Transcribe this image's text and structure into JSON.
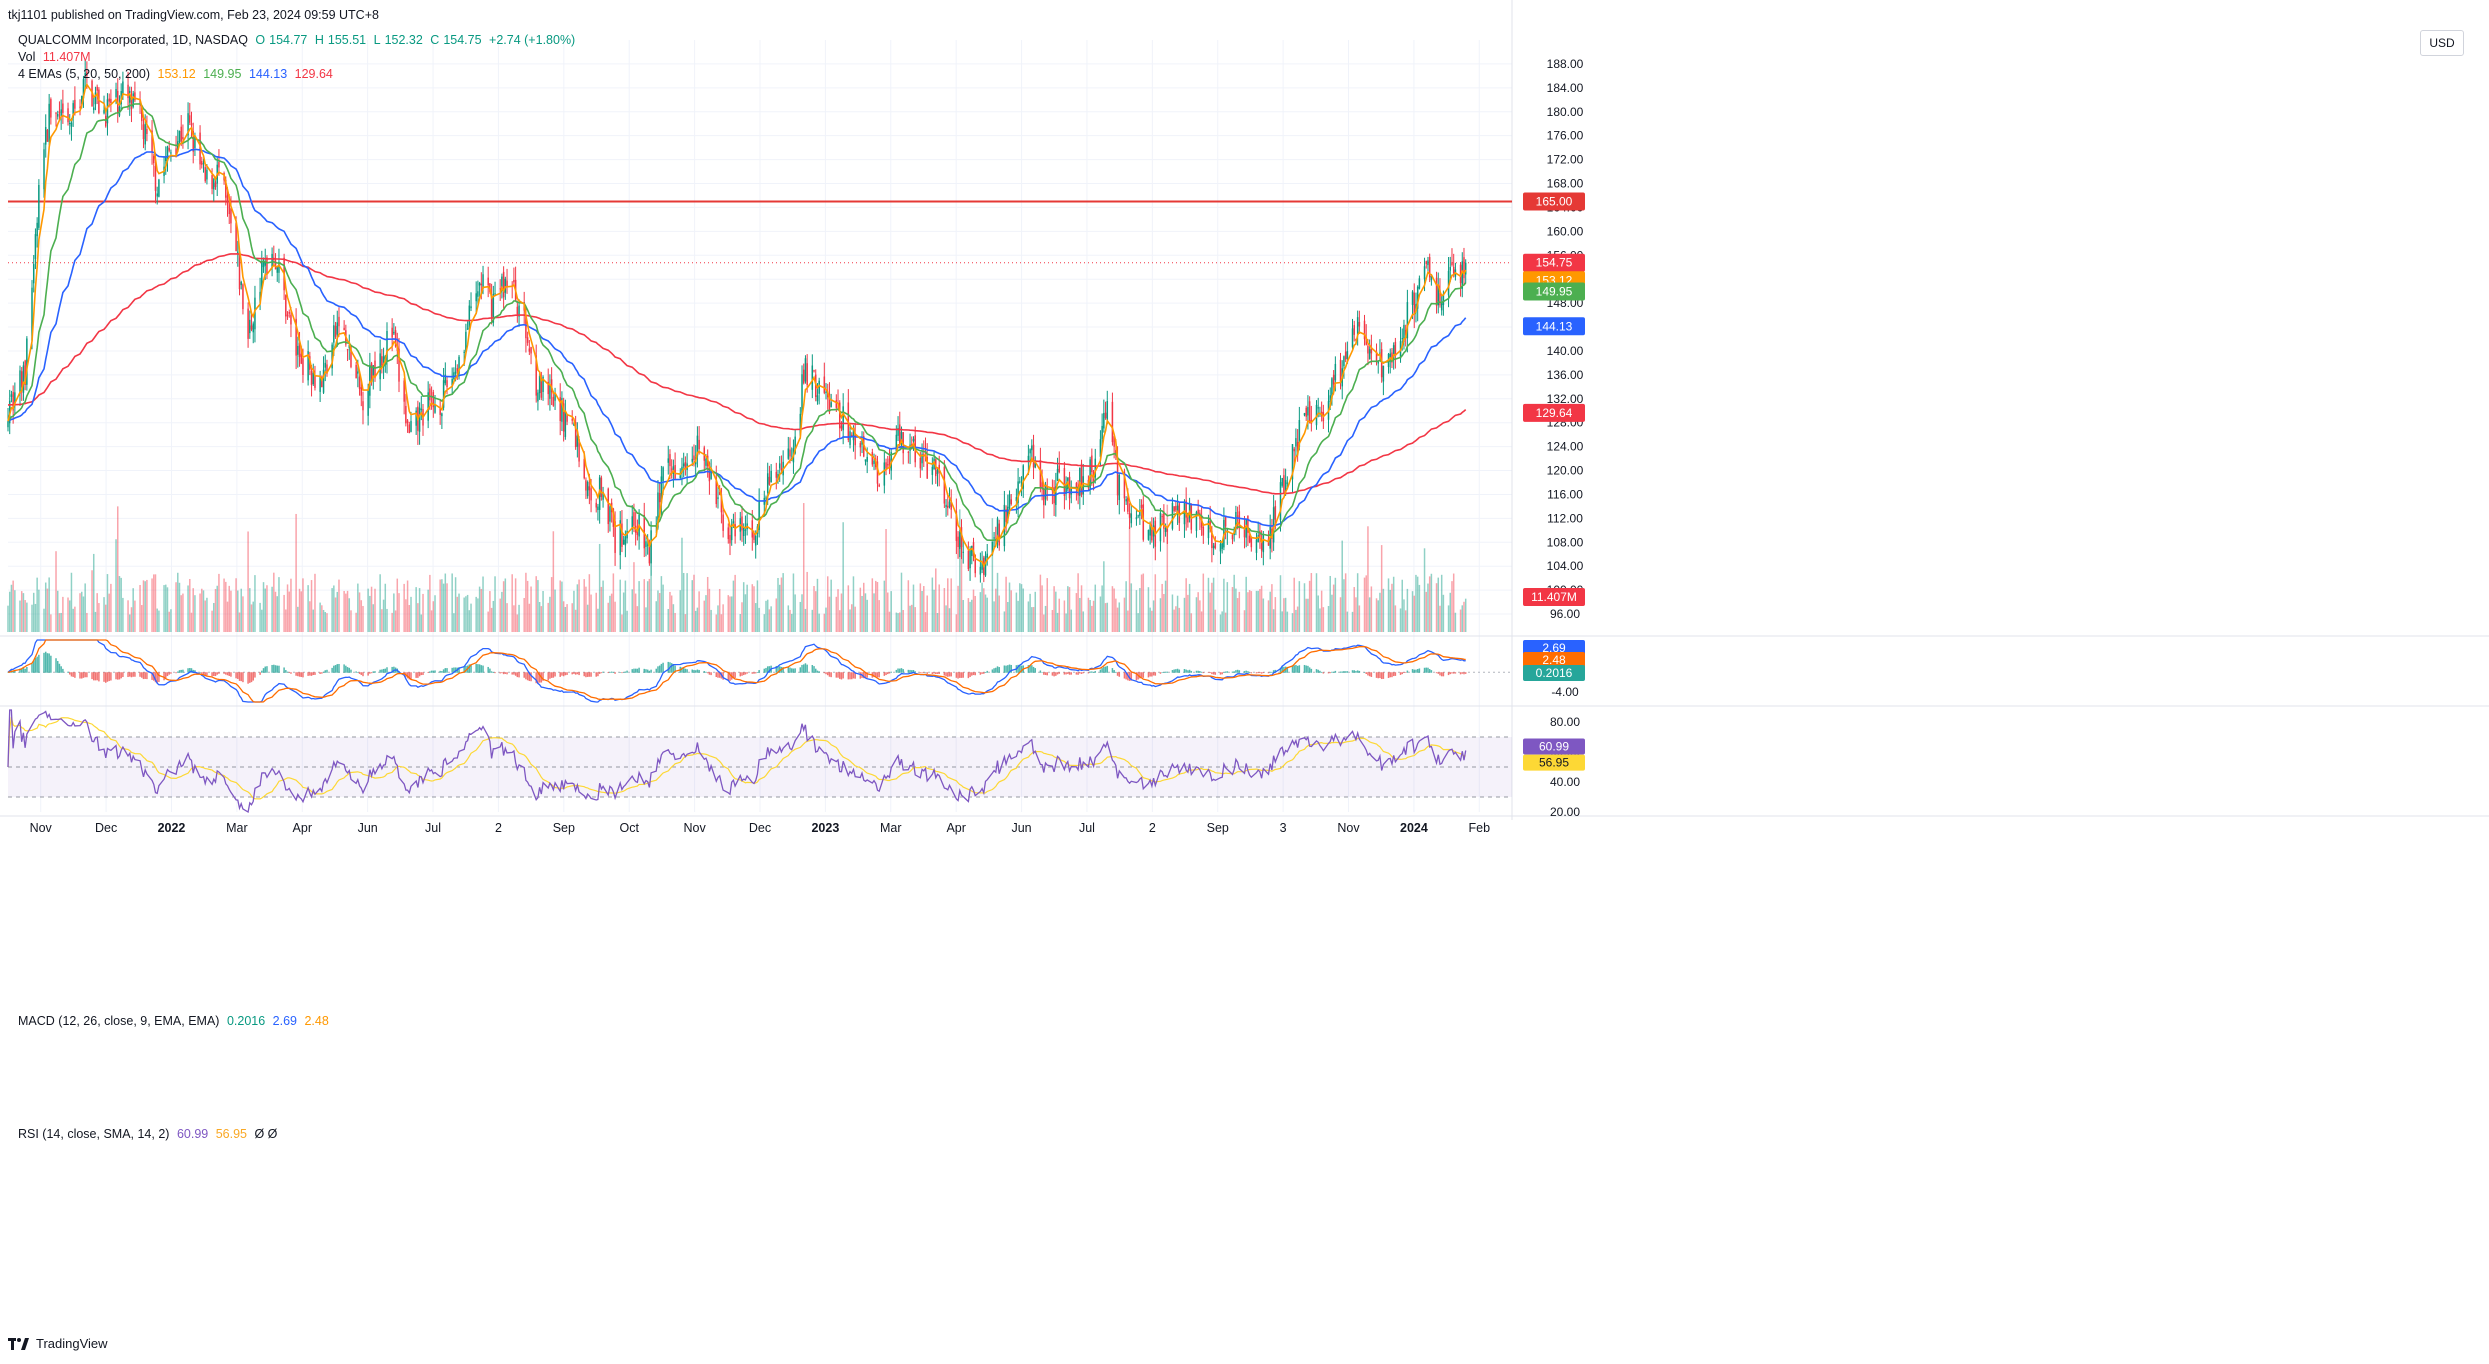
{
  "header": {
    "published": "tkj1101 published on TradingView.com, Feb 23, 2024 09:59 UTC+8",
    "symbol": "QUALCOMM Incorporated, 1D, NASDAQ",
    "open_label": "O",
    "open": "154.77",
    "high_label": "H",
    "high": "155.51",
    "low_label": "L",
    "low": "152.32",
    "close_label": "C",
    "close": "154.75",
    "change": "+2.74 (+1.80%)",
    "vol_label": "Vol",
    "vol": "11.407M",
    "ema_label": "4 EMAs (5, 20, 50, 200)",
    "ema5": "153.12",
    "ema20": "149.95",
    "ema50": "144.13",
    "ema200": "129.64"
  },
  "currency": "USD",
  "footer": {
    "brand": "TradingView"
  },
  "macd_header": {
    "label": "MACD (12, 26, close, 9, EMA, EMA)",
    "hist": "0.2016",
    "macd": "2.69",
    "signal": "2.48"
  },
  "rsi_header": {
    "label": "RSI (14, close, SMA, 14, 2)",
    "rsi": "60.99",
    "ma": "56.95",
    "extra": "Ø Ø"
  },
  "colors": {
    "up": "#089981",
    "down": "#f23645",
    "ema5": "#ff9800",
    "ema20": "#4caf50",
    "ema50": "#2962ff",
    "ema200": "#f23645",
    "rsi": "#7e57c2",
    "rsi_ma": "#fdd835",
    "hline": "#e53935"
  },
  "chart_data": [
    {
      "type": "candlestick",
      "title": "QUALCOMM Incorporated, 1D, NASDAQ",
      "ylim": [
        93,
        192
      ],
      "y_ticks": [
        96,
        100,
        104,
        108,
        112,
        116,
        120,
        124,
        128,
        132,
        136,
        140,
        144,
        148,
        152,
        156,
        160,
        164,
        168,
        172,
        176,
        180,
        184,
        188
      ],
      "x_ticks": [
        "Nov",
        "Dec",
        "2022",
        "Mar",
        "Apr",
        "Jun",
        "Jul",
        "2",
        "Sep",
        "Oct",
        "Nov",
        "Dec",
        "2023",
        "Mar",
        "Apr",
        "Jun",
        "Jul",
        "2",
        "Sep",
        "3",
        "Nov",
        "2024",
        "Feb"
      ],
      "x_range": [
        "2021-10-25",
        "2024-03-20"
      ],
      "horizontal_line": {
        "value": 165.0,
        "label": "165.00"
      },
      "last_price_line": 154.75,
      "price_labels": [
        {
          "value": 154.75,
          "label": "154.75",
          "color": "#f23645"
        },
        {
          "value": 153.12,
          "label": "153.12",
          "color": "#ff9800"
        },
        {
          "value": 149.95,
          "label": "149.95",
          "color": "#4caf50"
        },
        {
          "value": 144.13,
          "label": "144.13",
          "color": "#2962ff"
        },
        {
          "value": 129.64,
          "label": "129.64",
          "color": "#f23645"
        }
      ],
      "volume_label": "11.407M",
      "price_anchors": [
        [
          "2021-10-25",
          131
        ],
        [
          "2021-11-04",
          136
        ],
        [
          "2021-11-12",
          166
        ],
        [
          "2021-11-18",
          180
        ],
        [
          "2021-11-29",
          177
        ],
        [
          "2021-12-09",
          185
        ],
        [
          "2021-12-20",
          180
        ],
        [
          "2021-12-31",
          183
        ],
        [
          "2022-01-10",
          179
        ],
        [
          "2022-01-20",
          168
        ],
        [
          "2022-01-28",
          174
        ],
        [
          "2022-02-07",
          178
        ],
        [
          "2022-02-17",
          168
        ],
        [
          "2022-02-25",
          170
        ],
        [
          "2022-03-07",
          156
        ],
        [
          "2022-03-14",
          142
        ],
        [
          "2022-03-22",
          153
        ],
        [
          "2022-03-29",
          157
        ],
        [
          "2022-04-11",
          140
        ],
        [
          "2022-04-26",
          135
        ],
        [
          "2022-05-06",
          145
        ],
        [
          "2022-05-19",
          132
        ],
        [
          "2022-05-27",
          138
        ],
        [
          "2022-06-06",
          143
        ],
        [
          "2022-06-16",
          125
        ],
        [
          "2022-06-24",
          130
        ],
        [
          "2022-07-05",
          132
        ],
        [
          "2022-07-14",
          138
        ],
        [
          "2022-07-28",
          152
        ],
        [
          "2022-08-02",
          148
        ],
        [
          "2022-08-12",
          152
        ],
        [
          "2022-08-19",
          148
        ],
        [
          "2022-08-30",
          134
        ],
        [
          "2022-09-09",
          131
        ],
        [
          "2022-09-20",
          127
        ],
        [
          "2022-09-30",
          114
        ],
        [
          "2022-10-07",
          118
        ],
        [
          "2022-10-14",
          108
        ],
        [
          "2022-10-25",
          112
        ],
        [
          "2022-11-03",
          106
        ],
        [
          "2022-11-10",
          118
        ],
        [
          "2022-11-18",
          121
        ],
        [
          "2022-12-01",
          125
        ],
        [
          "2022-12-09",
          118
        ],
        [
          "2022-12-20",
          109
        ],
        [
          "2023-01-03",
          110
        ],
        [
          "2023-01-12",
          118
        ],
        [
          "2023-01-25",
          124
        ],
        [
          "2023-02-02",
          137
        ],
        [
          "2023-02-09",
          134
        ],
        [
          "2023-02-17",
          131
        ],
        [
          "2023-02-27",
          127
        ],
        [
          "2023-03-09",
          124
        ],
        [
          "2023-03-17",
          119
        ],
        [
          "2023-03-28",
          126
        ],
        [
          "2023-04-10",
          122
        ],
        [
          "2023-04-20",
          119
        ],
        [
          "2023-04-28",
          112
        ],
        [
          "2023-05-05",
          106
        ],
        [
          "2023-05-15",
          104
        ],
        [
          "2023-05-26",
          110
        ],
        [
          "2023-06-05",
          118
        ],
        [
          "2023-06-14",
          123
        ],
        [
          "2023-06-22",
          116
        ],
        [
          "2023-06-30",
          118
        ],
        [
          "2023-07-12",
          118
        ],
        [
          "2023-07-21",
          121
        ],
        [
          "2023-07-27",
          131
        ],
        [
          "2023-08-03",
          118
        ],
        [
          "2023-08-14",
          112
        ],
        [
          "2023-08-25",
          109
        ],
        [
          "2023-09-05",
          114
        ],
        [
          "2023-09-15",
          112
        ],
        [
          "2023-09-26",
          109
        ],
        [
          "2023-10-06",
          111
        ],
        [
          "2023-10-16",
          110
        ],
        [
          "2023-10-27",
          108
        ],
        [
          "2023-11-01",
          110
        ],
        [
          "2023-11-09",
          120
        ],
        [
          "2023-11-20",
          128
        ],
        [
          "2023-12-01",
          131
        ],
        [
          "2023-12-12",
          138
        ],
        [
          "2023-12-22",
          144
        ],
        [
          "2024-01-03",
          137
        ],
        [
          "2024-01-12",
          141
        ],
        [
          "2024-01-24",
          149
        ],
        [
          "2024-01-31",
          155
        ],
        [
          "2024-02-06",
          149
        ],
        [
          "2024-02-14",
          152
        ],
        [
          "2024-02-22",
          154.75
        ]
      ],
      "series": [
        {
          "name": "EMA 5",
          "last": 153.12
        },
        {
          "name": "EMA 20",
          "last": 149.95
        },
        {
          "name": "EMA 50",
          "last": 144.13
        },
        {
          "name": "EMA 200",
          "last": 129.64
        }
      ]
    },
    {
      "type": "bar",
      "title": "MACD (12, 26, close, 9, EMA, EMA)",
      "ylim": [
        -6,
        6.5
      ],
      "y_ticks": [
        -4.0
      ],
      "values": {
        "histogram": 0.2016,
        "macd": 2.69,
        "signal": 2.48
      }
    },
    {
      "type": "line",
      "title": "RSI (14, close, SMA, 14, 2)",
      "ylim": [
        20,
        88
      ],
      "y_ticks": [
        20.0,
        40.0,
        60.0,
        80.0
      ],
      "bands": {
        "upper": 70,
        "middle": 50,
        "lower": 30
      },
      "values": {
        "rsi": 60.99,
        "ma": 56.95
      }
    }
  ]
}
